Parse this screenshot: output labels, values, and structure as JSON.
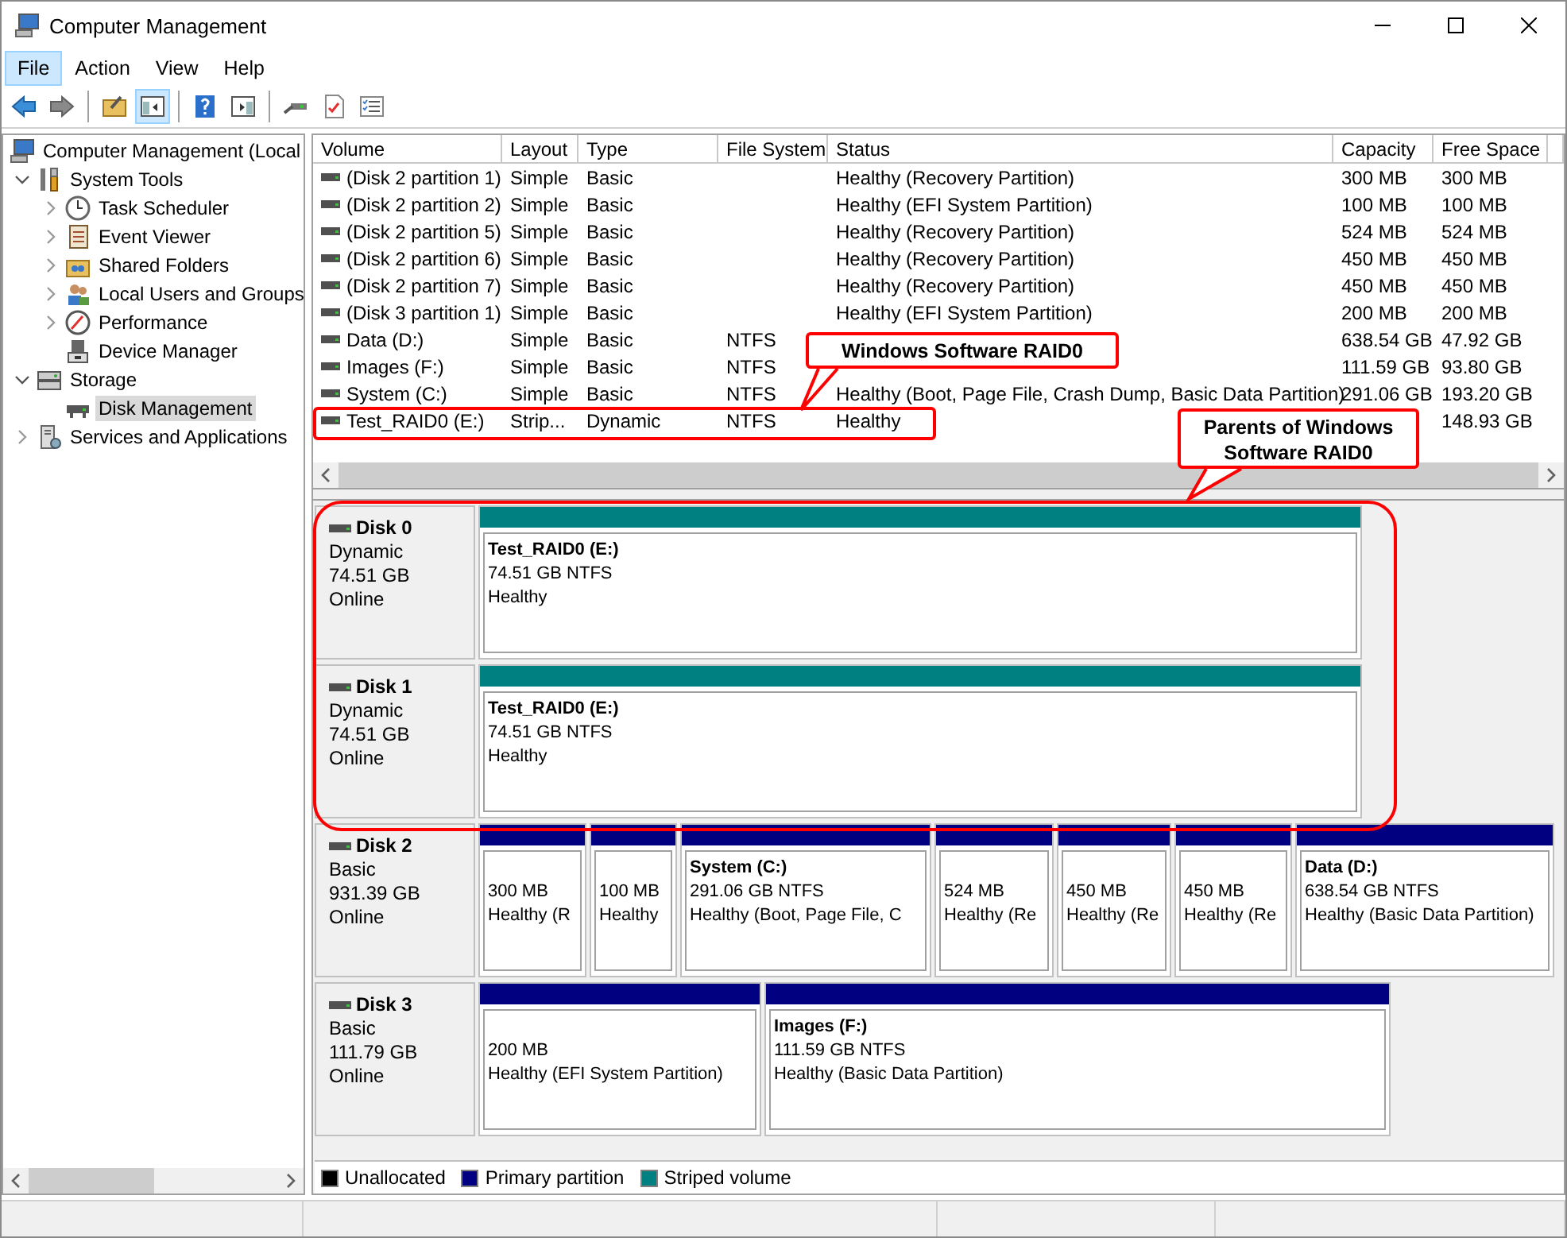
{
  "window": {
    "title": "Computer Management"
  },
  "menu": [
    {
      "label": "File",
      "selected": true
    },
    {
      "label": "Action",
      "selected": false
    },
    {
      "label": "View",
      "selected": false
    },
    {
      "label": "Help",
      "selected": false
    }
  ],
  "toolbar": [
    {
      "pressed": false
    },
    {
      "pressed": false
    },
    {
      "pressed": false
    },
    {
      "pressed": true
    },
    {
      "pressed": false
    },
    {
      "pressed": false
    },
    {
      "pressed": false
    },
    {
      "pressed": false
    },
    {
      "pressed": false
    }
  ],
  "tree": [
    {
      "label": "Computer Management (Local",
      "selected": false,
      "children": [
        {
          "label": "System Tools",
          "selected": false,
          "expanded": true,
          "children": [
            {
              "label": "Task Scheduler",
              "selected": false,
              "expanded": false
            },
            {
              "label": "Event Viewer",
              "selected": false,
              "expanded": false
            },
            {
              "label": "Shared Folders",
              "selected": false,
              "expanded": false
            },
            {
              "label": "Local Users and Groups",
              "selected": false,
              "expanded": false
            },
            {
              "label": "Performance",
              "selected": false,
              "expanded": false
            },
            {
              "label": "Device Manager",
              "selected": false
            }
          ]
        },
        {
          "label": "Storage",
          "selected": false,
          "expanded": true,
          "children": [
            {
              "label": "Disk Management",
              "selected": true
            }
          ]
        },
        {
          "label": "Services and Applications",
          "selected": false,
          "expanded": false
        }
      ]
    }
  ],
  "volumes": {
    "columns": [
      "Volume",
      "Layout",
      "Type",
      "File System",
      "Status",
      "Capacity",
      "Free Space"
    ],
    "rows": [
      {
        "volume": "(Disk 2 partition 1)",
        "layout": "Simple",
        "type": "Basic",
        "status": "Healthy (Recovery Partition)",
        "capacity": "300 MB",
        "free_space": "300 MB",
        "highlighted": false
      },
      {
        "volume": "(Disk 2 partition 2)",
        "layout": "Simple",
        "type": "Basic",
        "status": "Healthy (EFI System Partition)",
        "capacity": "100 MB",
        "free_space": "100 MB",
        "highlighted": false
      },
      {
        "volume": "(Disk 2 partition 5)",
        "layout": "Simple",
        "type": "Basic",
        "status": "Healthy (Recovery Partition)",
        "capacity": "524 MB",
        "free_space": "524 MB",
        "highlighted": false
      },
      {
        "volume": "(Disk 2 partition 6)",
        "layout": "Simple",
        "type": "Basic",
        "status": "Healthy (Recovery Partition)",
        "capacity": "450 MB",
        "free_space": "450 MB",
        "highlighted": false
      },
      {
        "volume": "(Disk 2 partition 7)",
        "layout": "Simple",
        "type": "Basic",
        "status": "Healthy (Recovery Partition)",
        "capacity": "450 MB",
        "free_space": "450 MB",
        "highlighted": false
      },
      {
        "volume": "(Disk 3 partition 1)",
        "layout": "Simple",
        "type": "Basic",
        "status": "Healthy (EFI System Partition)",
        "capacity": "200 MB",
        "free_space": "200 MB",
        "highlighted": false
      },
      {
        "volume": "Data (D:)",
        "layout": "Simple",
        "type": "Basic",
        "file_system": "NTFS",
        "capacity": "638.54 GB",
        "free_space": "47.92 GB",
        "highlighted": false
      },
      {
        "volume": "Images (F:)",
        "layout": "Simple",
        "type": "Basic",
        "file_system": "NTFS",
        "capacity": "111.59 GB",
        "free_space": "93.80 GB",
        "highlighted": false
      },
      {
        "volume": "System (C:)",
        "layout": "Simple",
        "type": "Basic",
        "file_system": "NTFS",
        "status": "Healthy (Boot, Page File, Crash Dump, Basic Data Partition)",
        "capacity": "291.06 GB",
        "free_space": "193.20 GB",
        "highlighted": false
      },
      {
        "volume": "Test_RAID0 (E:)",
        "layout": "Strip...",
        "type": "Dynamic",
        "file_system": "NTFS",
        "status": "Healthy",
        "free_space": "148.93 GB",
        "highlighted": true
      }
    ]
  },
  "disks": [
    {
      "name": "Disk 0",
      "type": "Dynamic",
      "size": "74.51 GB",
      "status": "Online",
      "highlighted": true,
      "partitions": [
        {
          "kind": "striped",
          "name": "Test_RAID0  (E:)",
          "size": "74.51 GB NTFS",
          "status": "Healthy"
        }
      ]
    },
    {
      "name": "Disk 1",
      "type": "Dynamic",
      "size": "74.51 GB",
      "status": "Online",
      "highlighted": true,
      "partitions": [
        {
          "kind": "striped",
          "name": "Test_RAID0  (E:)",
          "size": "74.51 GB NTFS",
          "status": "Healthy"
        }
      ]
    },
    {
      "name": "Disk 2",
      "type": "Basic",
      "size": "931.39 GB",
      "status": "Online",
      "highlighted": false,
      "partitions": [
        {
          "kind": "primary",
          "size": "300 MB",
          "status": "Healthy (R"
        },
        {
          "kind": "primary",
          "size": "100 MB",
          "status": "Healthy"
        },
        {
          "kind": "primary",
          "name": "System  (C:)",
          "size": "291.06 GB NTFS",
          "status": "Healthy (Boot, Page File, C"
        },
        {
          "kind": "primary",
          "size": "524 MB",
          "status": "Healthy (Re"
        },
        {
          "kind": "primary",
          "size": "450 MB",
          "status": "Healthy (Re"
        },
        {
          "kind": "primary",
          "size": "450 MB",
          "status": "Healthy (Re"
        },
        {
          "kind": "primary",
          "name": "Data  (D:)",
          "size": "638.54 GB NTFS",
          "status": "Healthy (Basic Data Partition)"
        }
      ]
    },
    {
      "name": "Disk 3",
      "type": "Basic",
      "size": "111.79 GB",
      "status": "Online",
      "highlighted": false,
      "partitions": [
        {
          "kind": "primary",
          "size": "200 MB",
          "status": "Healthy (EFI System Partition)"
        },
        {
          "kind": "primary",
          "name": "Images  (F:)",
          "size": "111.59 GB NTFS",
          "status": "Healthy (Basic Data Partition)"
        }
      ]
    }
  ],
  "legend": [
    {
      "label": "Unallocated",
      "color": "#000000"
    },
    {
      "label": "Primary partition",
      "color": "#000080"
    },
    {
      "label": "Striped volume",
      "color": "#008080"
    }
  ],
  "callouts": [
    {
      "text": "Windows Software RAID0"
    },
    {
      "text": "Parents of Windows Software RAID0"
    }
  ]
}
